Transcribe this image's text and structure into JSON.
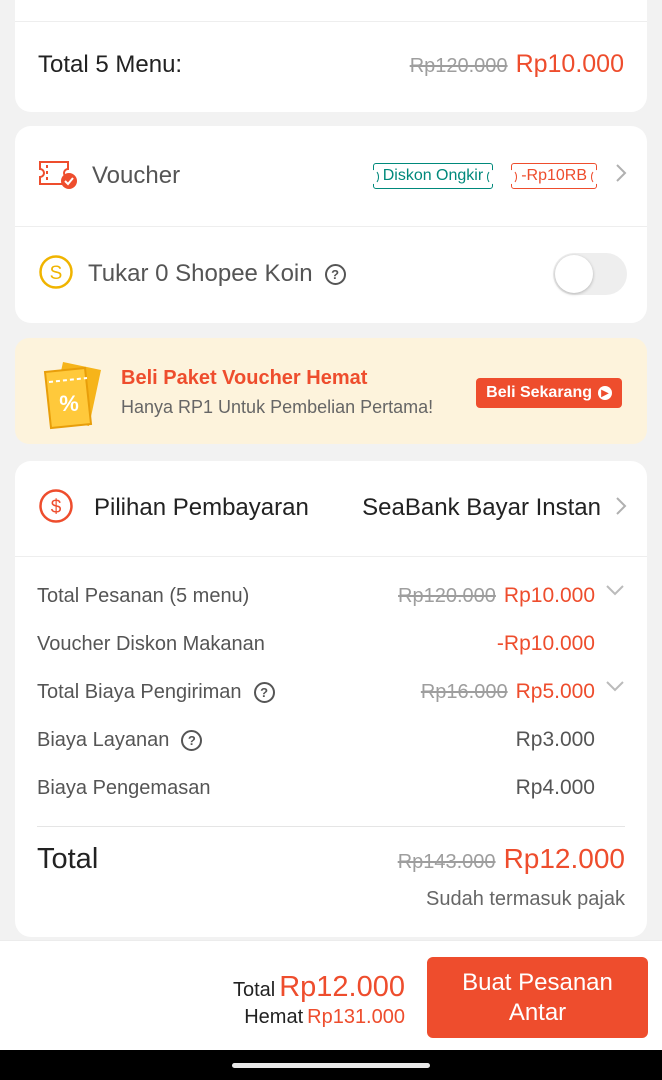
{
  "summary_top": {
    "label": "Total 5 Menu:",
    "price_old": "Rp120.000",
    "price_new": "Rp10.000"
  },
  "voucher": {
    "label": "Voucher",
    "tag_shipping": "Diskon Ongkir",
    "tag_discount": "-Rp10RB"
  },
  "coins": {
    "label": "Tukar 0 Shopee Koin",
    "toggle_on": false
  },
  "banner": {
    "title": "Beli Paket Voucher Hemat",
    "subtitle": "Hanya RP1 Untuk Pembelian Pertama!",
    "button": "Beli Sekarang",
    "icon_text": "%"
  },
  "payment": {
    "label": "Pilihan Pembayaran",
    "method": "SeaBank Bayar Instan"
  },
  "breakdown": {
    "order": {
      "label": "Total Pesanan (5 menu)",
      "old": "Rp120.000",
      "new": "Rp10.000"
    },
    "food_voucher": {
      "label": "Voucher Diskon Makanan",
      "value": "-Rp10.000"
    },
    "shipping": {
      "label": "Total Biaya Pengiriman",
      "old": "Rp16.000",
      "new": "Rp5.000"
    },
    "service": {
      "label": "Biaya Layanan",
      "value": "Rp3.000"
    },
    "packaging": {
      "label": "Biaya Pengemasan",
      "value": "Rp4.000"
    }
  },
  "grand_total": {
    "label": "Total",
    "old": "Rp143.000",
    "new": "Rp12.000",
    "note": "Sudah termasuk pajak"
  },
  "bottom": {
    "total_label": "Total",
    "total_value": "Rp12.000",
    "save_label": "Hemat",
    "save_value": "Rp131.000",
    "cta": "Buat Pesanan Antar"
  },
  "colors": {
    "accent": "#ee4d2d",
    "green_tag": "#00897b",
    "coin": "#f0b400",
    "banner_bg": "#fdf3dc"
  }
}
